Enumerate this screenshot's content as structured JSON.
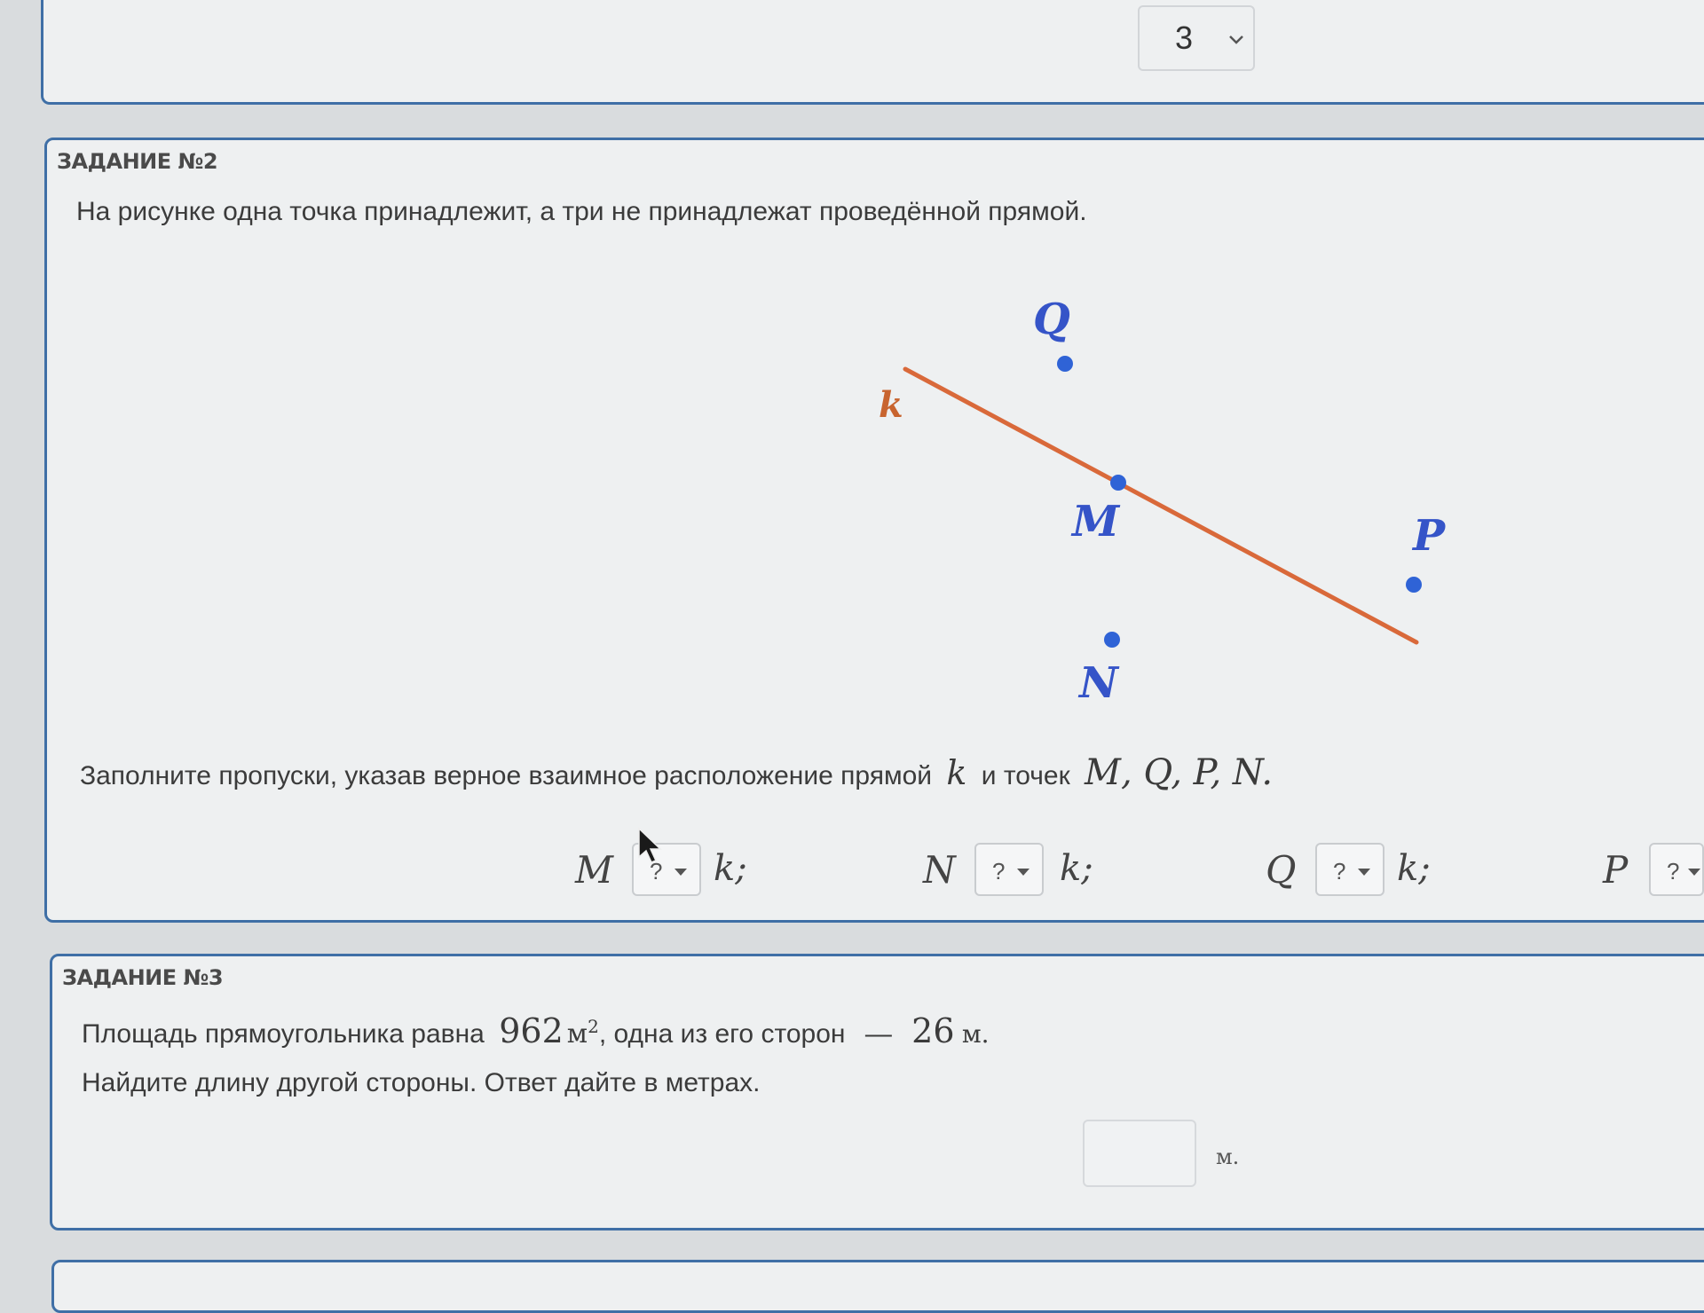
{
  "top_card": {
    "select_value": "3"
  },
  "task2": {
    "header": "ЗАДАНИЕ №2",
    "intro": "На рисунке одна точка принадлежит, а три не принадлежат проведённой прямой.",
    "figure": {
      "line_label": "k",
      "points": [
        {
          "name": "Q"
        },
        {
          "name": "M"
        },
        {
          "name": "P"
        },
        {
          "name": "N"
        }
      ],
      "colors": {
        "line": "#d9693a",
        "points": "#2f63d6",
        "labels": "#3554c8",
        "line_label": "#c8642f"
      }
    },
    "prompt_text": "Заполните пропуски, указав верное взаимное расположение прямой",
    "prompt_var": "k",
    "prompt_text2": "и точек",
    "prompt_points": "M, Q, P, N.",
    "blanks": [
      {
        "point": "M",
        "value": "?",
        "line": "k;"
      },
      {
        "point": "N",
        "value": "?",
        "line": "k;"
      },
      {
        "point": "Q",
        "value": "?",
        "line": "k;"
      },
      {
        "point": "P",
        "value": "?",
        "line": ""
      }
    ]
  },
  "task3": {
    "header": "ЗАДАНИЕ №3",
    "line1_a": "Площадь прямоугольника равна",
    "area_value": "962",
    "area_unit": "м",
    "area_exp": "2",
    "line1_b": ", одна из его сторон",
    "dash": "—",
    "side_value": "26",
    "side_unit": "м.",
    "line2": "Найдите длину другой стороны. Ответ дайте в метрах.",
    "answer_value": "",
    "answer_unit": "м."
  },
  "colors": {
    "card_border": "#3f6fa6",
    "card_bg": "#eef0f1"
  }
}
